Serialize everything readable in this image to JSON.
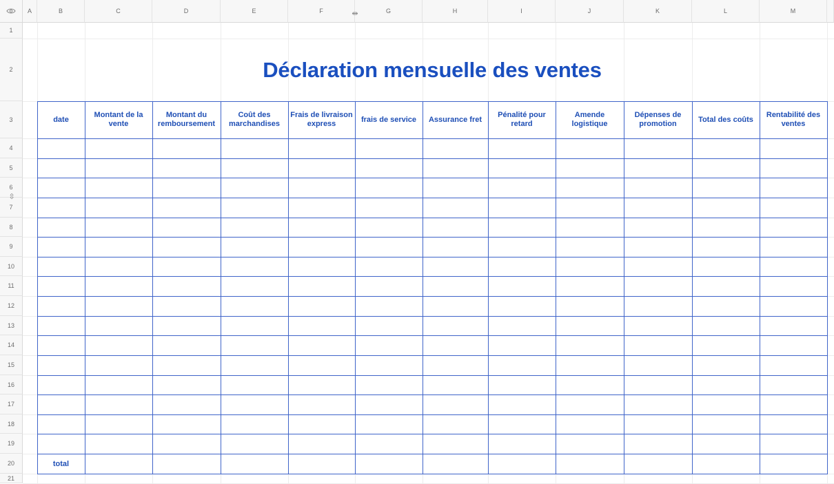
{
  "sheet": {
    "columns": [
      "A",
      "B",
      "C",
      "D",
      "E",
      "F",
      "G",
      "H",
      "I",
      "J",
      "K",
      "L",
      "M"
    ],
    "rows": [
      "1",
      "2",
      "3",
      "4",
      "5",
      "6",
      "7",
      "8",
      "9",
      "10",
      "11",
      "12",
      "13",
      "14",
      "15",
      "16",
      "17",
      "18",
      "19",
      "20",
      "21"
    ]
  },
  "title": "Déclaration mensuelle des ventes",
  "table": {
    "headers": [
      "date",
      "Montant de la vente",
      "Montant du remboursement",
      "Coût des marchandises",
      "Frais de livraison express",
      "frais de service",
      "Assurance fret",
      "Pénalité pour retard",
      "Amende logistique",
      "Dépenses de promotion",
      "Total des coûts",
      "Rentabilité des ventes"
    ],
    "total_label": "total"
  },
  "colors": {
    "accent": "#1a4fbf",
    "border": "#3e63c9",
    "header_bg": "#f7f7f7"
  },
  "icons": {
    "corner": "eye-icon",
    "column_resize": "column-resize-icon",
    "row_resize": "row-resize-icon"
  }
}
